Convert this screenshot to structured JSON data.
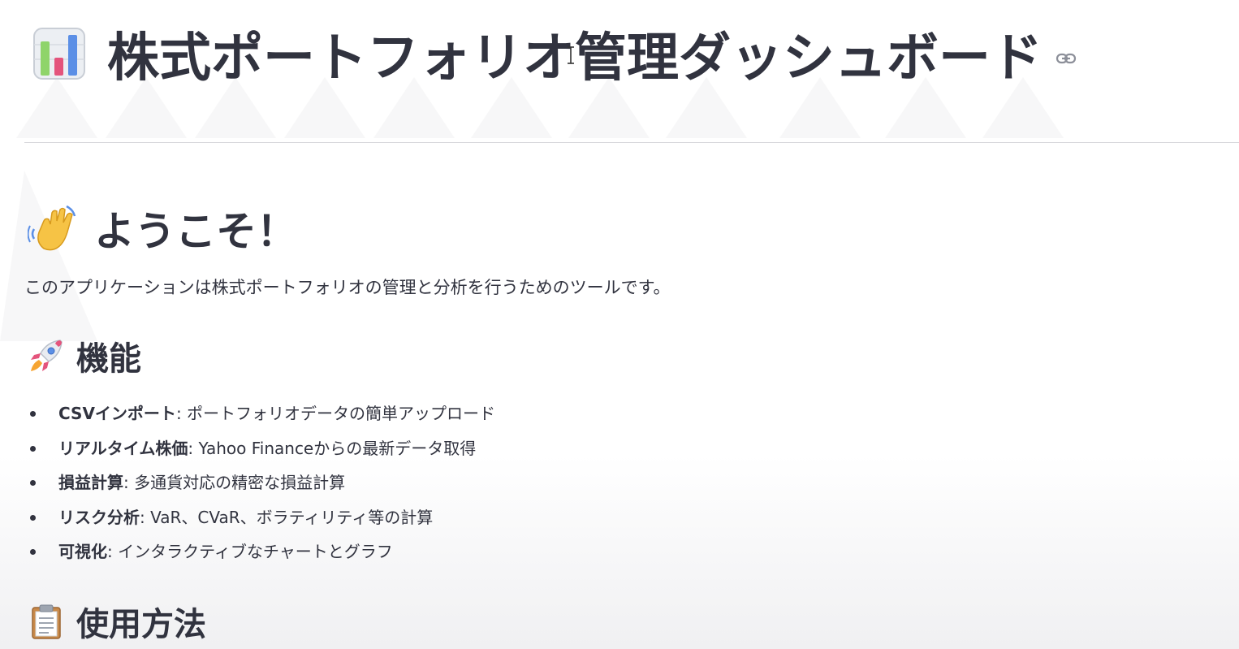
{
  "header": {
    "title": "株式ポートフォリオ管理ダッシュボード",
    "title_icon": "bar-chart-icon",
    "anchor_icon": "link-icon"
  },
  "welcome": {
    "heading": "ようこそ！",
    "heading_icon": "waving-hand-icon",
    "intro": "このアプリケーションは株式ポートフォリオの管理と分析を行うためのツールです。"
  },
  "features": {
    "heading": "機能",
    "heading_icon": "rocket-icon",
    "items": [
      {
        "name": "CSVインポート",
        "desc": ": ポートフォリオデータの簡単アップロード"
      },
      {
        "name": "リアルタイム株価",
        "desc": ": Yahoo Financeからの最新データ取得"
      },
      {
        "name": "損益計算",
        "desc": ": 多通貨対応の精密な損益計算"
      },
      {
        "name": "リスク分析",
        "desc": ": VaR、CVaR、ボラティリティ等の計算"
      },
      {
        "name": "可視化",
        "desc": ": インタラクティブなチャートとグラフ"
      }
    ]
  },
  "usage": {
    "heading": "使用方法",
    "heading_icon": "clipboard-icon"
  },
  "colors": {
    "text": "#31333f",
    "divider": "#d6d6db",
    "background": "#ffffff"
  }
}
